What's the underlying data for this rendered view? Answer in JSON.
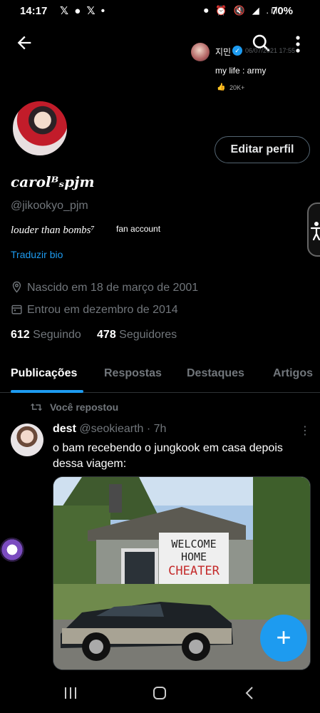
{
  "status_bar": {
    "time": "14:17",
    "left_icons": "𝕏 ● 𝕏 •",
    "right_icons": "⏺ ⏰ 🔇 ◢ .ıl",
    "battery": "70%"
  },
  "header_overlay": {
    "name": "지민",
    "date": "06/07/2021 17:55",
    "text": "my life : army",
    "likes": "20K+"
  },
  "profile": {
    "edit_button": "Editar perfil",
    "display_name": "carolᴮₛpjm",
    "handle": "@jikookyo_pjm",
    "bio": "louder than bombs⁷",
    "bio_extra": "fan account",
    "translate_link": "Traduzir bio",
    "born": "Nascido em 18 de março de 2001",
    "joined": "Entrou em dezembro de 2014",
    "following_count": "612",
    "following_label": "Seguindo",
    "followers_count": "478",
    "followers_label": "Seguidores"
  },
  "tabs": [
    {
      "label": "Publicações"
    },
    {
      "label": "Respostas"
    },
    {
      "label": "Destaques"
    },
    {
      "label": "Artigos"
    }
  ],
  "tweet": {
    "repost_label": "Você repostou",
    "author_name": "dest",
    "author_handle": "@seokiearth",
    "time": "· 7h",
    "text": "o bam recebendo o jungkook em casa depois dessa viagem:",
    "banner_lines": [
      "WELCOME",
      "HOME",
      "CHEATER"
    ]
  },
  "fab": {
    "label": "+"
  },
  "colors": {
    "accent": "#1d9bf0",
    "muted": "#71767b",
    "background": "#000000"
  }
}
